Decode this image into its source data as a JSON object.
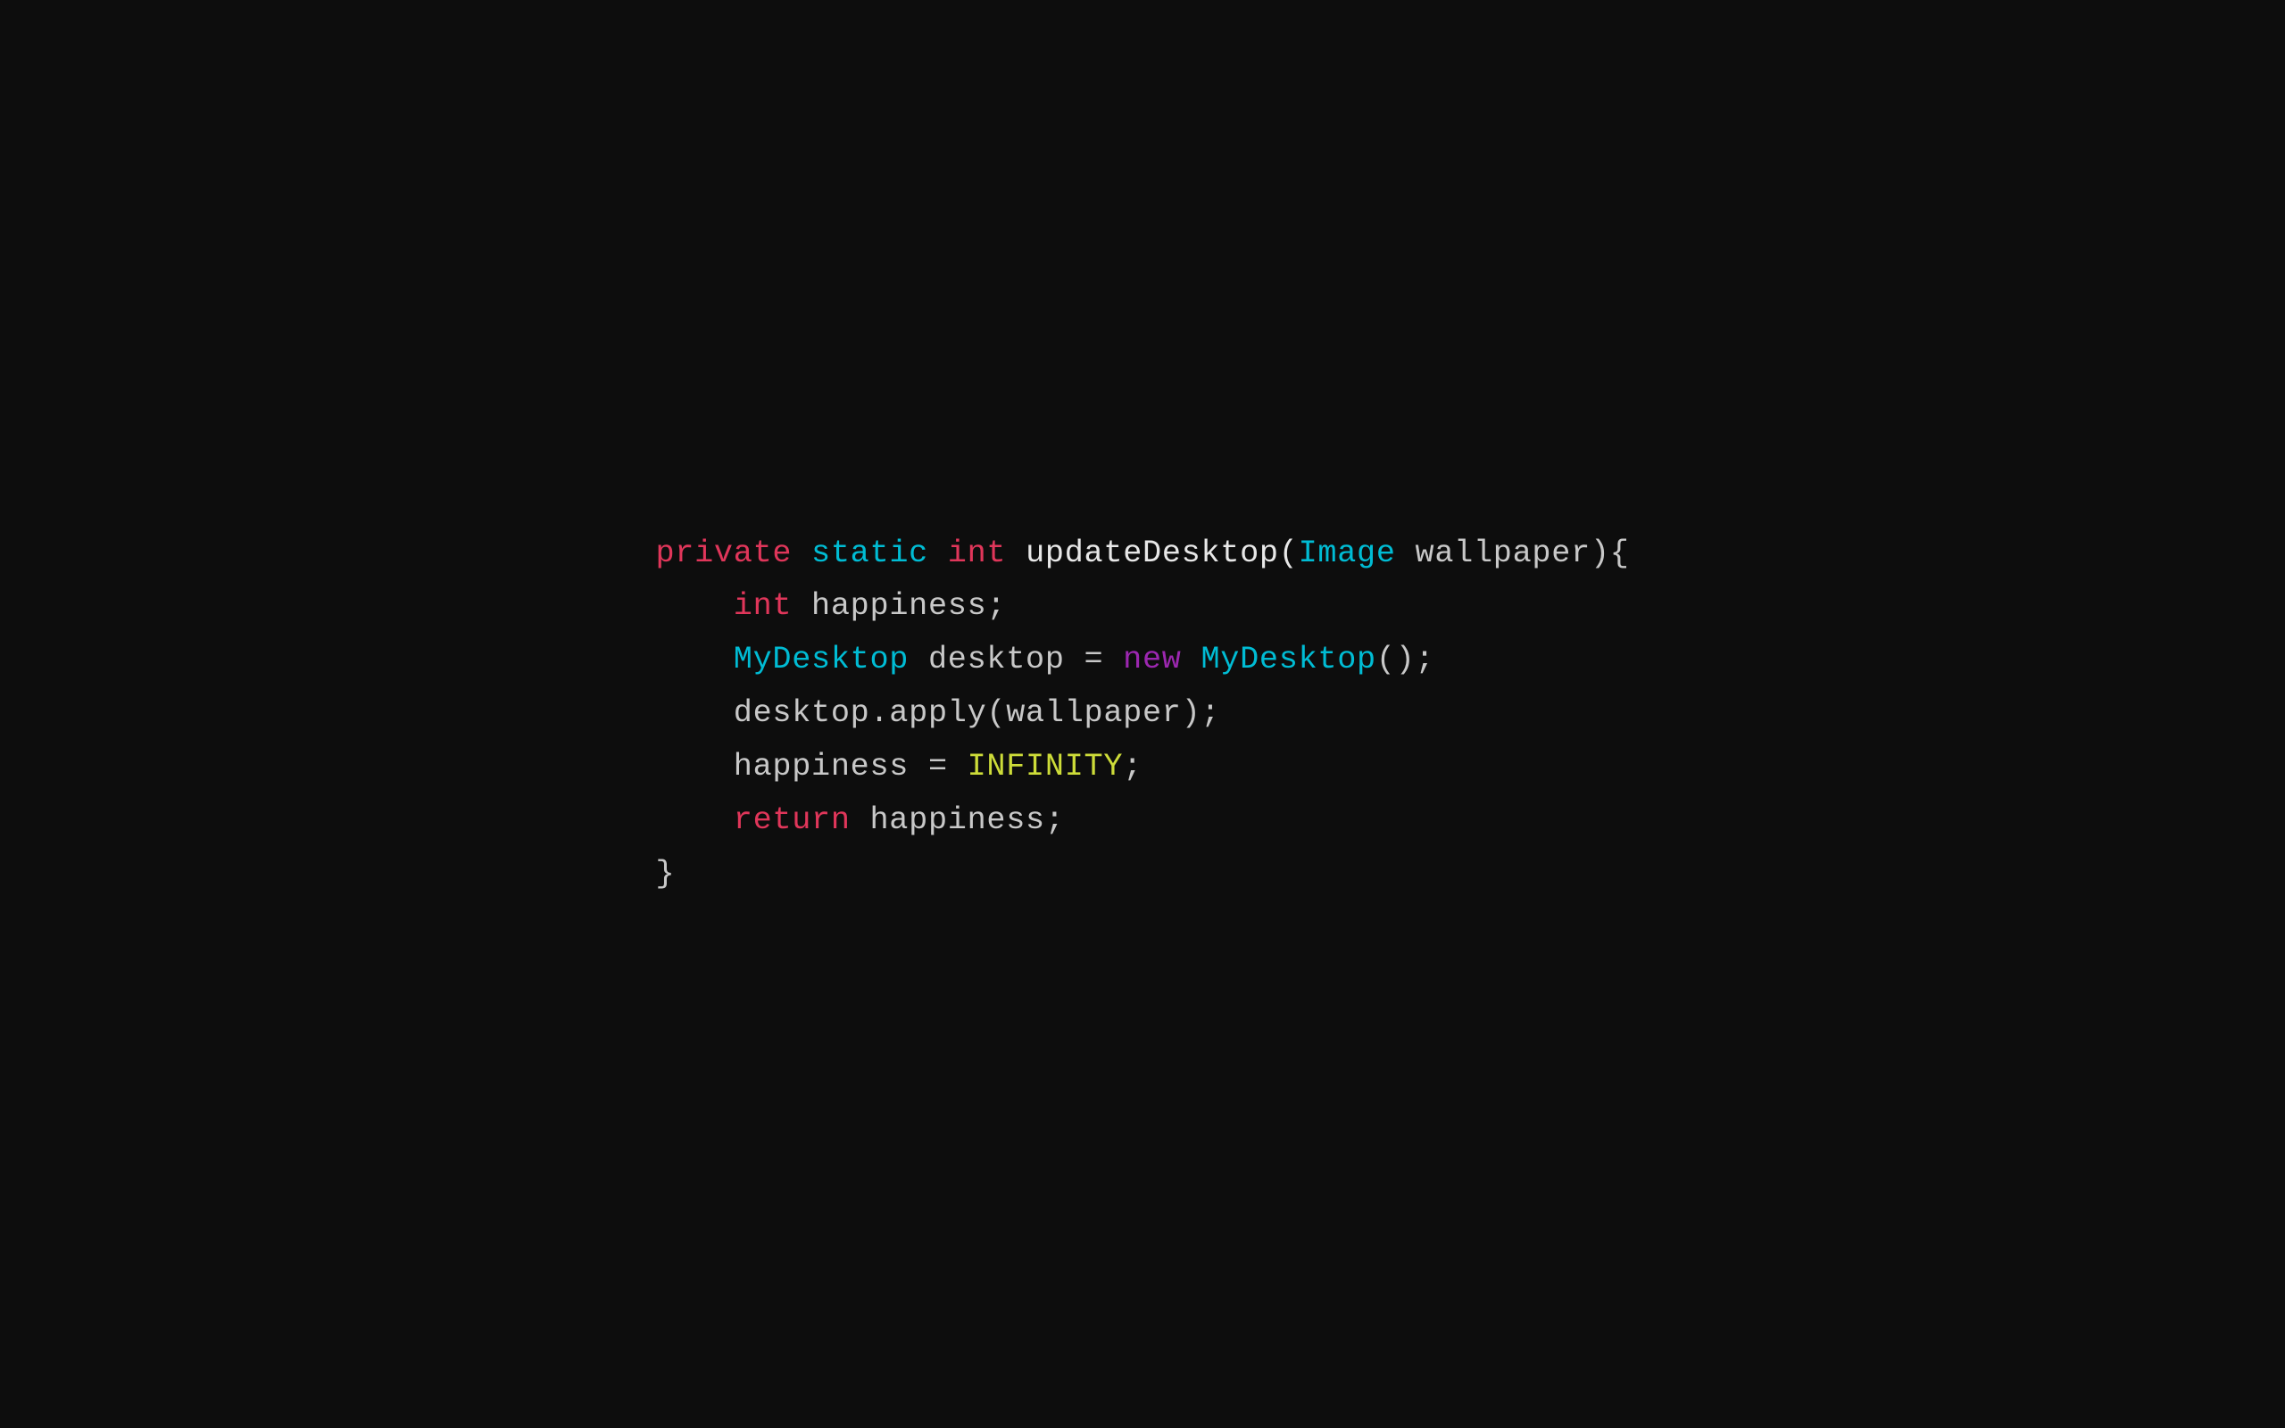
{
  "code": {
    "line1": {
      "private": "private",
      "space1": " ",
      "static": "static",
      "space2": " ",
      "int": "int",
      "space3": " ",
      "rest": "updateDesktop(",
      "image": "Image",
      "rest2": " wallpaper){"
    },
    "line2": {
      "indent": "    ",
      "int": "int",
      "rest": " happiness;"
    },
    "line3": {
      "indent": "    ",
      "mydesktop": "MyDesktop",
      "rest": " desktop = ",
      "new": "new",
      "rest2": " ",
      "mydesktop2": "MyDesktop",
      "rest3": "();"
    },
    "line4": {
      "indent": "    ",
      "rest": "desktop.apply(wallpaper);"
    },
    "line5": {
      "indent": "    ",
      "rest": "happiness = ",
      "infinity": "INFINITY",
      "rest2": ";"
    },
    "line6": {
      "indent": "    ",
      "return": "return",
      "rest": " happiness;"
    },
    "line7": {
      "rest": "}"
    }
  }
}
